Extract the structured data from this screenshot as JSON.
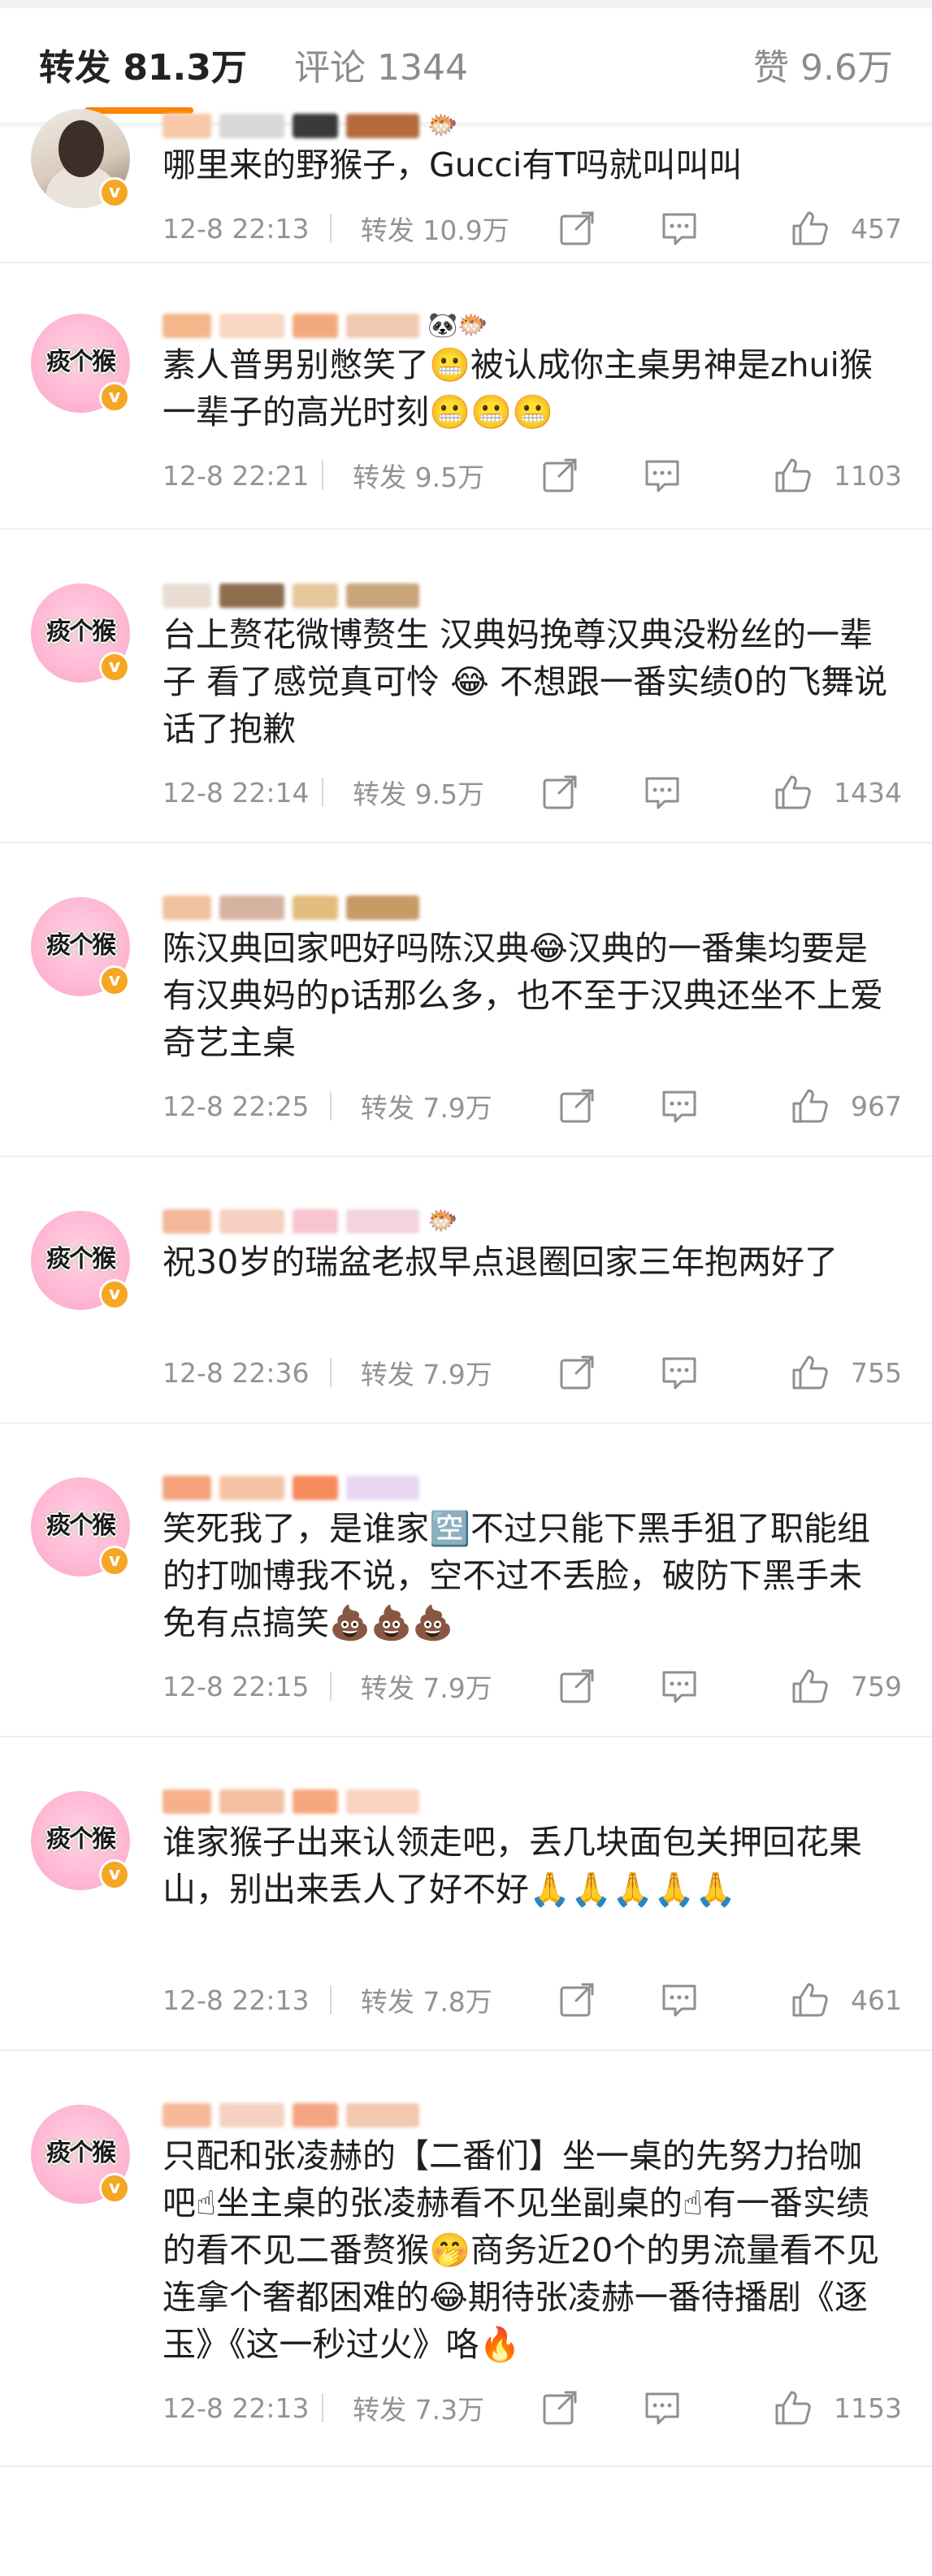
{
  "tabs": {
    "repost": "转发 81.3万",
    "comments": "评论 1344",
    "likes": "赞 9.6万"
  },
  "colors": {
    "accent": "#ff8200",
    "verified": "#f5a623",
    "meta_text": "#939393"
  },
  "comments": [
    {
      "avatar": "photo",
      "avatar_text": "",
      "text": "哪里来的野猴子，Gucci有T吗就叫叫叫",
      "time": "12-8 22:13",
      "reposts": "转发 10.9万",
      "likes": "457"
    },
    {
      "avatar": "pink",
      "avatar_text": "痰个猴",
      "text": "素人普男别憋笑了😬被认成你主桌男神是zhui猴一辈子的高光时刻😬😬😬",
      "time": "12-8 22:21",
      "reposts": "转发 9.5万",
      "likes": "1103"
    },
    {
      "avatar": "pink",
      "avatar_text": "痰个猴",
      "text": "台上赘花微博赘生 汉典妈挽尊汉典没粉丝的一辈子 看了感觉真可怜 😂 不想跟一番实绩0的飞舞说话了抱歉",
      "time": "12-8 22:14",
      "reposts": "转发 9.5万",
      "likes": "1434"
    },
    {
      "avatar": "pink",
      "avatar_text": "痰个猴",
      "text": "陈汉典回家吧好吗陈汉典😂汉典的一番集均要是有汉典妈的p话那么多，也不至于汉典还坐不上爱奇艺主桌",
      "time": "12-8 22:25",
      "reposts": "转发 7.9万",
      "likes": "967"
    },
    {
      "avatar": "pink",
      "avatar_text": "痰个猴",
      "text": "祝30岁的瑞盆老叔早点退圈回家三年抱两好了",
      "time": "12-8 22:36",
      "reposts": "转发 7.9万",
      "likes": "755"
    },
    {
      "avatar": "pink",
      "avatar_text": "痰个猴",
      "text": "笑死我了，是谁家🈳不过只能下黑手狙了职能组的打咖博我不说，空不过不丢脸，破防下黑手未免有点搞笑💩💩💩",
      "time": "12-8 22:15",
      "reposts": "转发 7.9万",
      "likes": "759"
    },
    {
      "avatar": "pink",
      "avatar_text": "痰个猴",
      "text": "谁家猴子出来认领走吧，丢几块面包关押回花果山，别出来丢人了好不好🙏🙏🙏🙏🙏",
      "time": "12-8 22:13",
      "reposts": "转发 7.8万",
      "likes": "461"
    },
    {
      "avatar": "pink",
      "avatar_text": "痰个猴",
      "text": "只配和张凌赫的【二番们】坐一桌的先努力抬咖吧☝坐主桌的张凌赫看不见坐副桌的☝有一番实绩的看不见二番赘猴🤭商务近20个的男流量看不见连拿个奢都困难的😂期待张凌赫一番待播剧《逐玉》《这一秒过火》咯🔥",
      "time": "12-8 22:13",
      "reposts": "转发 7.3万",
      "likes": "1153"
    }
  ]
}
